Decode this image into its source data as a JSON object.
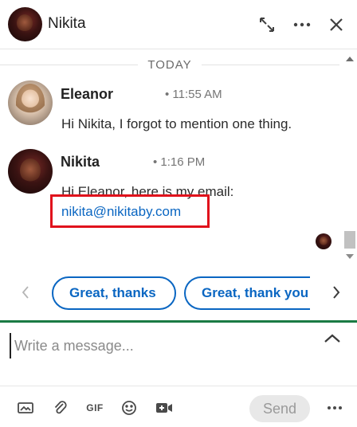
{
  "header": {
    "name": "Nikita"
  },
  "feed": {
    "day_divider": "TODAY",
    "messages": [
      {
        "sender": "Eleanor",
        "time": "• 11:55 AM",
        "text": "Hi Nikita, I forgot to mention one thing."
      },
      {
        "sender": "Nikita",
        "time": "• 1:16 PM",
        "text": "Hi Eleanor, here is my email:",
        "link": "nikita@nikitaby.com"
      }
    ]
  },
  "quick_replies": [
    "Great, thanks",
    "Great, thank you"
  ],
  "compose": {
    "placeholder": "Write a message..."
  },
  "toolbar": {
    "gif_label": "GIF",
    "send_label": "Send"
  },
  "colors": {
    "accent": "#0a66c2",
    "compose_border": "#1a7a44",
    "highlight": "#e0121c"
  }
}
